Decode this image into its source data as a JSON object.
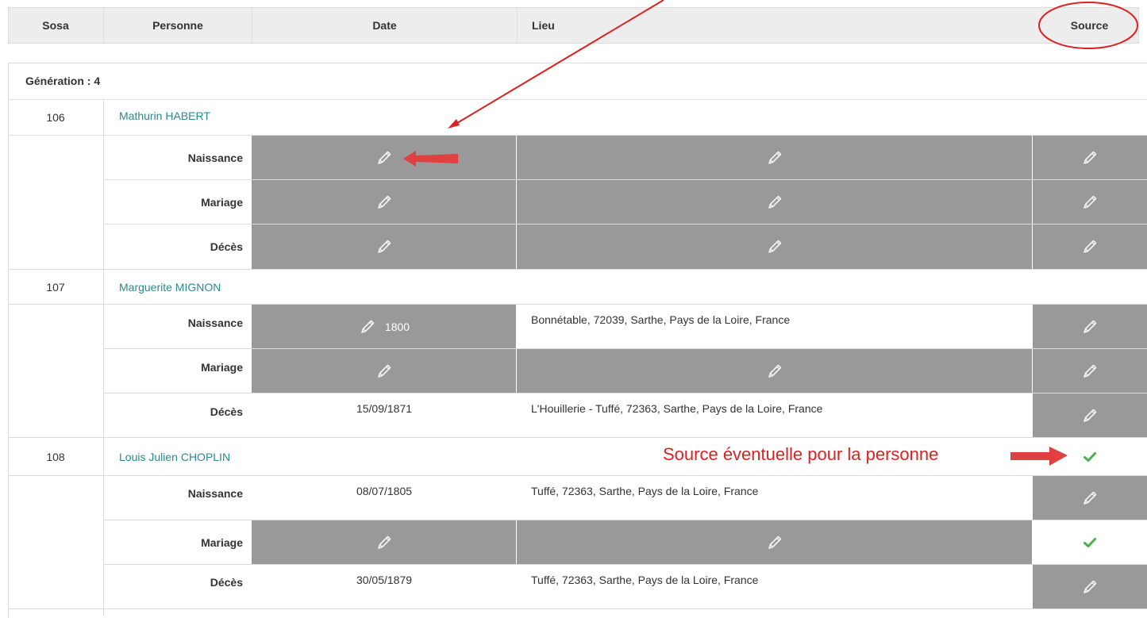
{
  "header": {
    "sosa": "Sosa",
    "personne": "Personne",
    "date": "Date",
    "lieu": "Lieu",
    "source": "Source"
  },
  "generation_label": "Génération : 4",
  "persons": [
    {
      "sosa": "106",
      "name": "Mathurin HABERT",
      "events": [
        {
          "label": "Naissance",
          "date": "",
          "lieu": ""
        },
        {
          "label": "Mariage",
          "date": "",
          "lieu": ""
        },
        {
          "label": "Décès",
          "date": "",
          "lieu": ""
        }
      ]
    },
    {
      "sosa": "107",
      "name": "Marguerite MIGNON",
      "events": [
        {
          "label": "Naissance",
          "date": "1800",
          "lieu": "Bonnétable, 72039, Sarthe, Pays de la Loire, France"
        },
        {
          "label": "Mariage",
          "date": "",
          "lieu": ""
        },
        {
          "label": "Décès",
          "date": "15/09/1871",
          "lieu": "L'Houillerie - Tuffé, 72363, Sarthe, Pays de la Loire, France"
        }
      ]
    },
    {
      "sosa": "108",
      "name": "Louis Julien CHOPLIN",
      "events": [
        {
          "label": "Naissance",
          "date": "08/07/1805",
          "lieu": "Tuffé, 72363, Sarthe, Pays de la Loire, France"
        },
        {
          "label": "Mariage",
          "date": "",
          "lieu": ""
        },
        {
          "label": "Décès",
          "date": "30/05/1879",
          "lieu": "Tuffé, 72363, Sarthe, Pays de la Loire, France"
        }
      ]
    }
  ],
  "annotation": {
    "text": "Source éventuelle pour la personne"
  },
  "colors": {
    "grey_cell": "#999999",
    "link": "#2a8a8c",
    "check": "#4caf50",
    "annotation": "#e02020"
  },
  "icons": [
    "pencil-icon",
    "check-icon"
  ]
}
